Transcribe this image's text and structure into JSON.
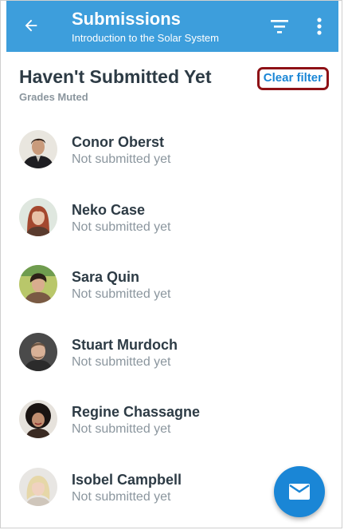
{
  "appbar": {
    "title": "Submissions",
    "subtitle": "Introduction to the Solar System",
    "back_icon": "arrow-left-icon",
    "filter_icon": "filter-icon",
    "more_icon": "more-vertical-icon",
    "color": "#3d9edc"
  },
  "section": {
    "title": "Haven't Submitted Yet",
    "subtitle": "Grades Muted",
    "clear_filter_label": "Clear filter"
  },
  "students": [
    {
      "name": "Conor Oberst",
      "status": "Not submitted yet"
    },
    {
      "name": "Neko Case",
      "status": "Not submitted yet"
    },
    {
      "name": "Sara Quin",
      "status": "Not submitted yet"
    },
    {
      "name": "Stuart Murdoch",
      "status": "Not submitted yet"
    },
    {
      "name": "Regine Chassagne",
      "status": "Not submitted yet"
    },
    {
      "name": "Isobel Campbell",
      "status": "Not submitted yet"
    }
  ],
  "fab": {
    "icon": "mail-icon",
    "color": "#1a86d6"
  }
}
